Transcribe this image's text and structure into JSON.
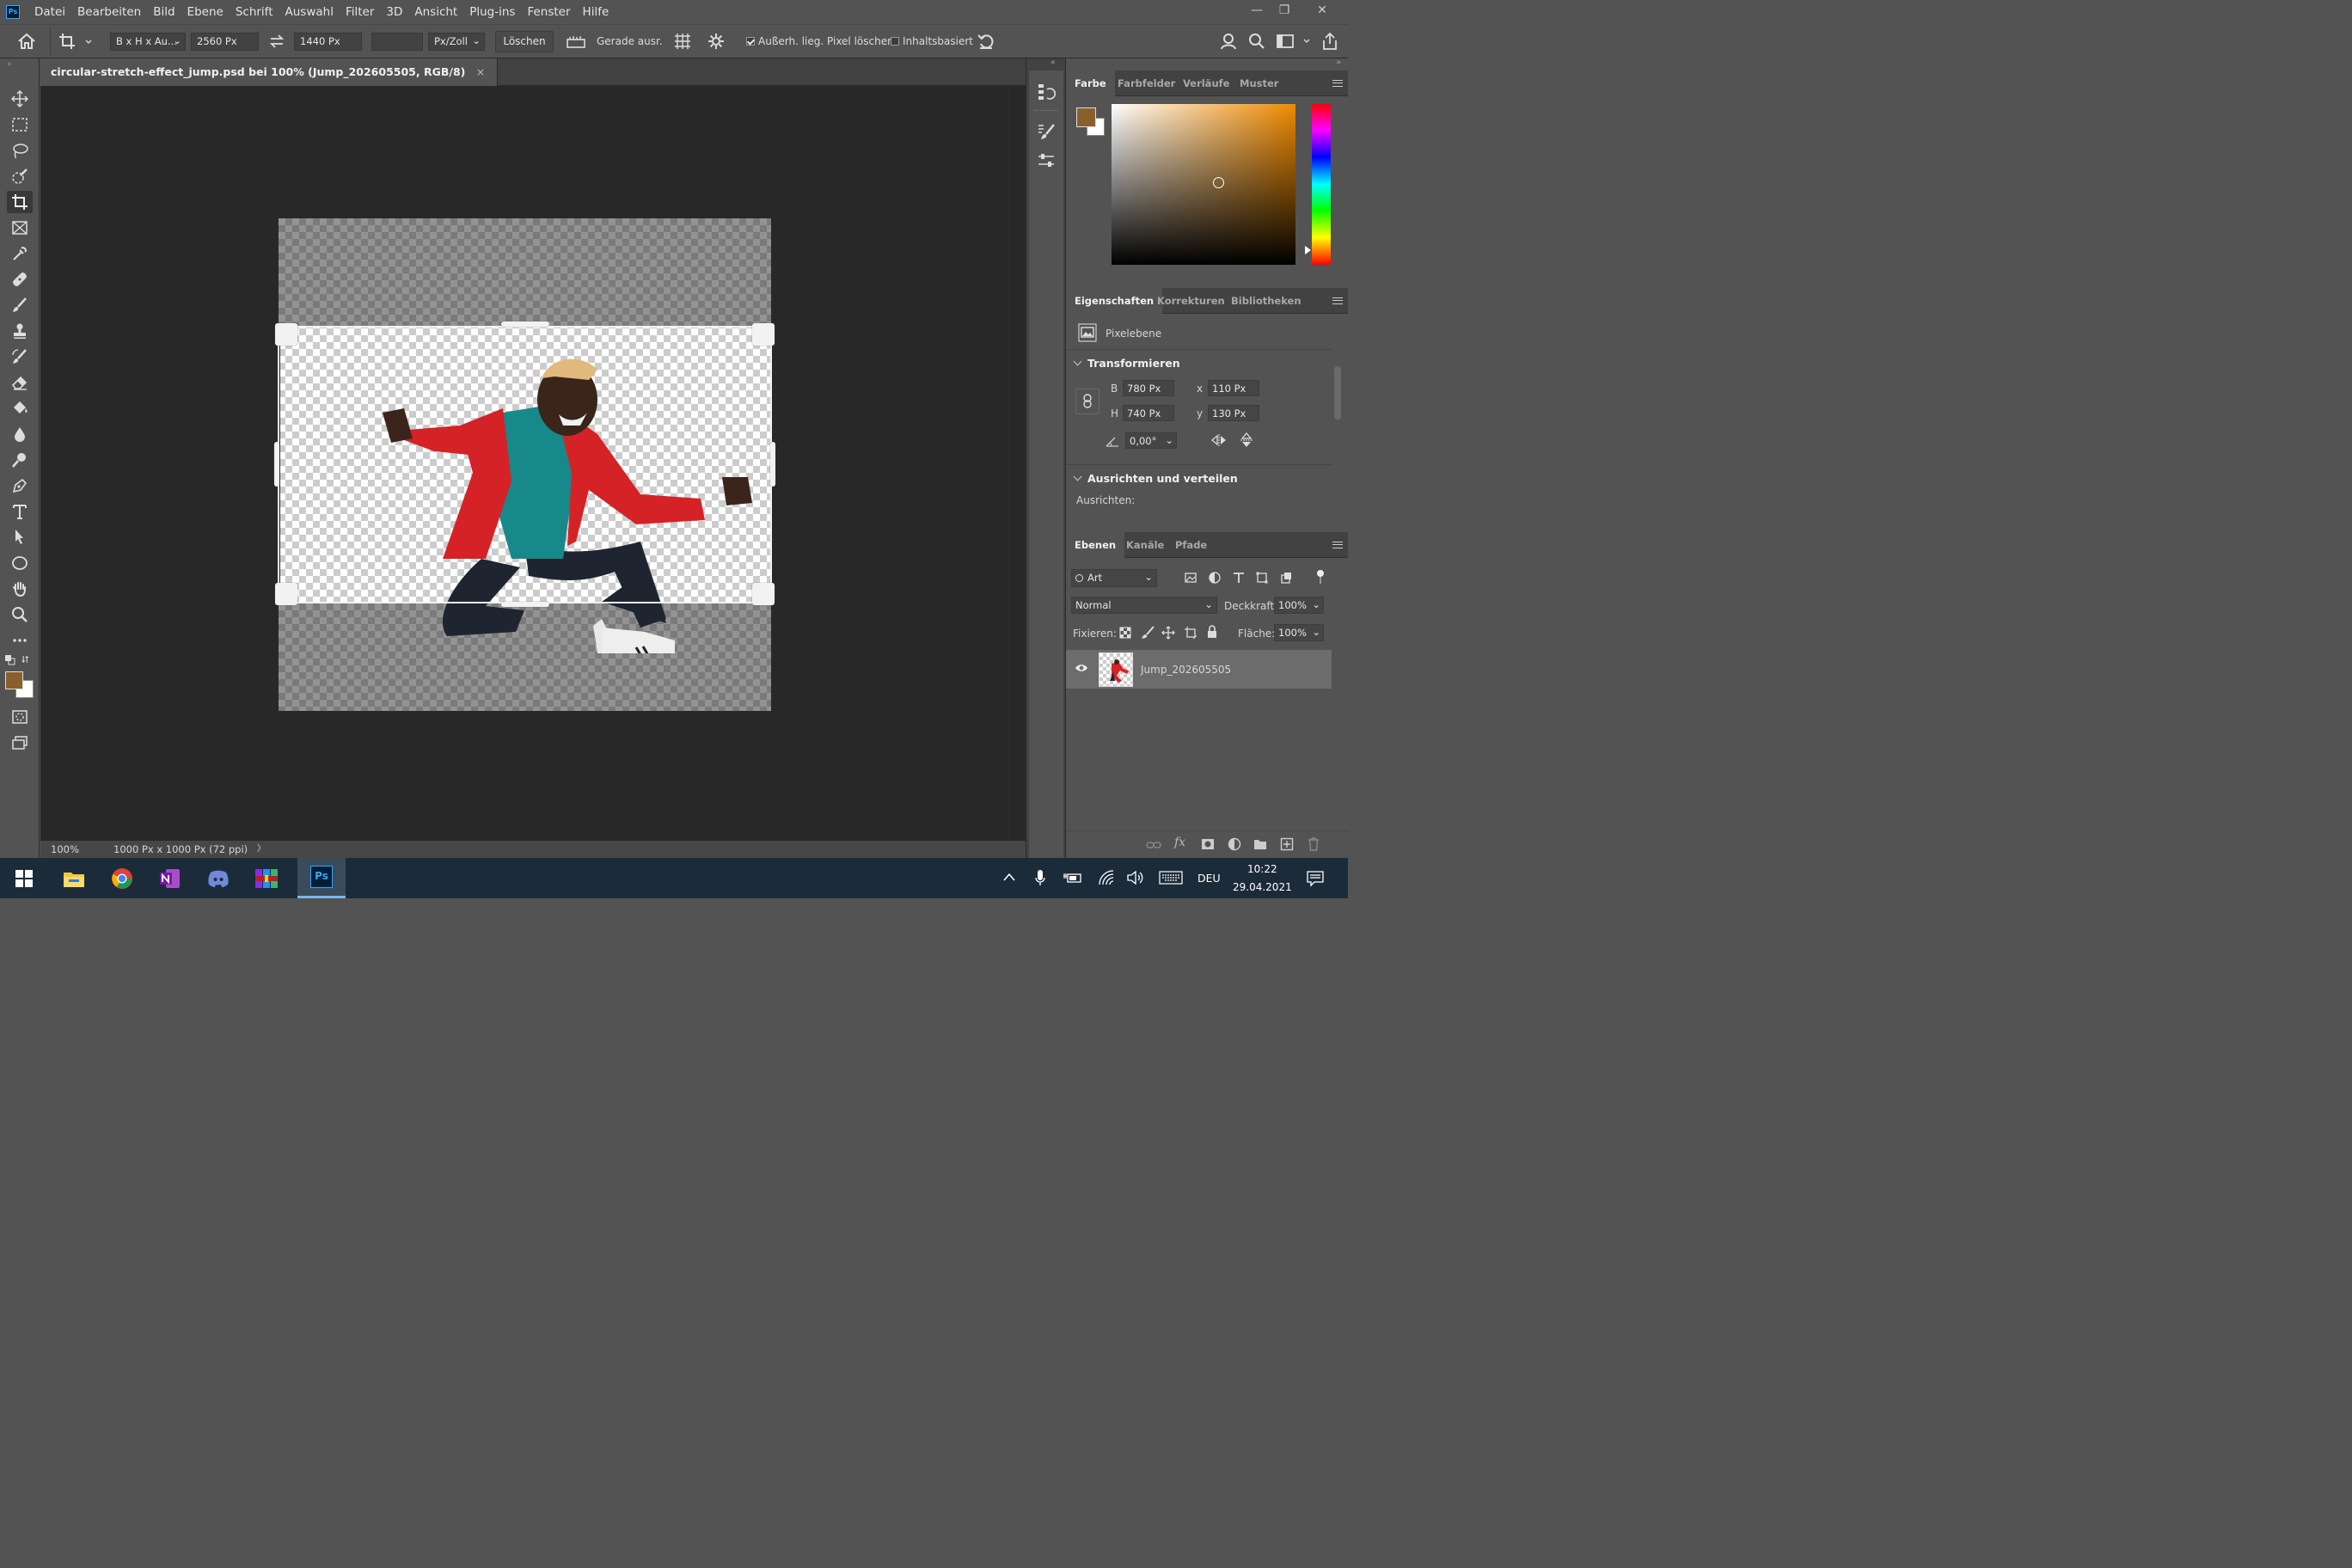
{
  "app": {
    "logo": "Ps"
  },
  "menu": [
    "Datei",
    "Bearbeiten",
    "Bild",
    "Ebene",
    "Schrift",
    "Auswahl",
    "Filter",
    "3D",
    "Ansicht",
    "Plug-ins",
    "Fenster",
    "Hilfe"
  ],
  "window_controls": {
    "minimize": "—",
    "restore": "❐",
    "close": "✕"
  },
  "options": {
    "ratio_select": "B x H x Au...",
    "width": "2560 Px",
    "height": "1440 Px",
    "resolution": "",
    "unit_select": "Px/Zoll",
    "clear_button": "Löschen",
    "straighten_label": "Gerade ausr.",
    "delete_pixels_label": "Außerh. lieg. Pixel löschen",
    "delete_pixels_checked": true,
    "content_aware_label": "Inhaltsbasiert",
    "content_aware_checked": false
  },
  "document": {
    "tab_title": "circular-stretch-effect_jump.psd bei 100% (Jump_202605505, RGB/8)",
    "tab_close": "×"
  },
  "status": {
    "zoom": "100%",
    "info": "1000 Px x 1000 Px (72 ppi)",
    "arrow": "〉"
  },
  "color_panel": {
    "tabs": [
      "Farbe",
      "Farbfelder",
      "Verläufe",
      "Muster"
    ],
    "foreground": "#8a5f2e",
    "background": "#ffffff",
    "hue_color": "#f08a00"
  },
  "properties_panel": {
    "tabs": [
      "Eigenschaften",
      "Korrekturen",
      "Bibliotheken"
    ],
    "layer_type": "Pixelebene",
    "transform_title": "Transformieren",
    "w_label": "B",
    "w_value": "780 Px",
    "h_label": "H",
    "h_value": "740 Px",
    "x_label": "x",
    "x_value": "110 Px",
    "y_label": "y",
    "y_value": "130 Px",
    "angle_value": "0,00°",
    "align_title": "Ausrichten und verteilen",
    "align_label": "Ausrichten:"
  },
  "layers_panel": {
    "tabs": [
      "Ebenen",
      "Kanäle",
      "Pfade"
    ],
    "filter_select": "Art",
    "blend_mode": "Normal",
    "opacity_label": "Deckkraft:",
    "opacity_value": "100%",
    "lock_label": "Fixieren:",
    "fill_label": "Fläche:",
    "fill_value": "100%",
    "layers": [
      {
        "name": "Jump_202605505",
        "visible": true
      }
    ]
  },
  "taskbar": {
    "language": "DEU",
    "time": "10:22",
    "date": "29.04.2021"
  }
}
